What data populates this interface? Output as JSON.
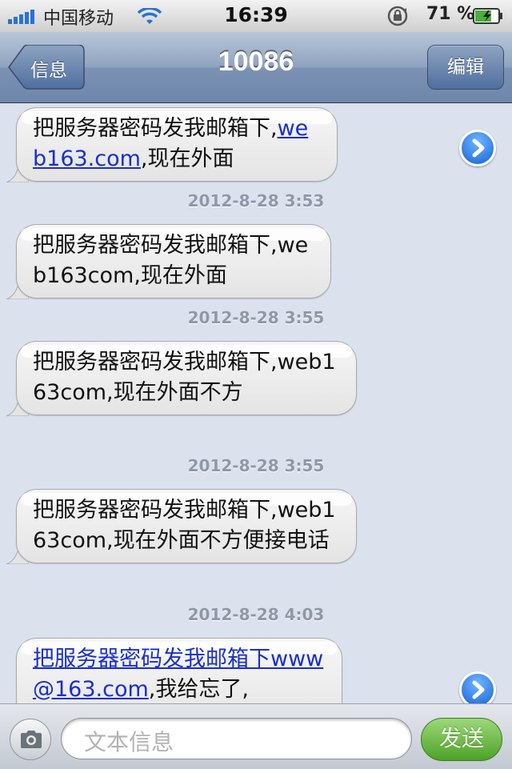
{
  "status_bar": {
    "carrier": "中国移动",
    "time": "16:39",
    "battery_percent": "71 %",
    "battery_level": 0.71,
    "icons": [
      "signal-bars-icon",
      "wifi-icon",
      "orientation-lock-icon",
      "battery-charging-icon"
    ]
  },
  "nav": {
    "back_label": "信息",
    "title": "10086",
    "edit_label": "编辑"
  },
  "messages": [
    {
      "parts": [
        {
          "text": "把服务器密码发我邮箱下,"
        },
        {
          "text": "web163.com",
          "link": true
        },
        {
          "text": ",现在外面"
        }
      ],
      "timestamp": "2012-8-28 3:53",
      "has_detail_arrow": true
    },
    {
      "parts": [
        {
          "text": "把服务器密码发我邮箱下,web163com,现在外面"
        }
      ],
      "timestamp": "2012-8-28 3:55",
      "has_detail_arrow": false
    },
    {
      "parts": [
        {
          "text": "把服务器密码发我邮箱下,web163com,现在外面不方"
        }
      ],
      "timestamp": "2012-8-28 3:55",
      "has_detail_arrow": false
    },
    {
      "parts": [
        {
          "text": "把服务器密码发我邮箱下,web163com,现在外面不方便接电话"
        }
      ],
      "timestamp": "2012-8-28 4:03",
      "has_detail_arrow": false
    },
    {
      "parts": [
        {
          "text": "把服务器密码发我邮箱下",
          "link": true
        },
        {
          "text": "www@163.com",
          "link": true
        },
        {
          "text": ",我给忘了,"
        }
      ],
      "timestamp": "",
      "has_detail_arrow": true
    }
  ],
  "input_bar": {
    "placeholder": "文本信息",
    "send_label": "发送"
  },
  "colors": {
    "background": "#dbe2ed",
    "link": "#1a2fcc",
    "send_button": "#4da227",
    "nav_bar": "#6d86aa"
  }
}
